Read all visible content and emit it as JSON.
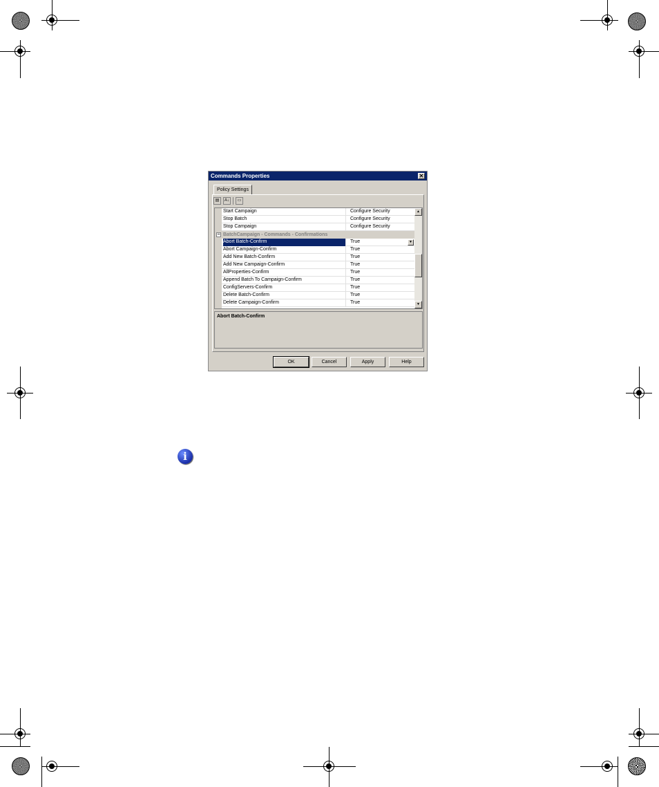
{
  "dialog": {
    "title": "Commands Properties",
    "close_glyph": "✕",
    "tab_label": "Policy Settings",
    "toolbar": {
      "categorized_glyph": "▤",
      "alphabetical_glyph": "A↓",
      "pages_glyph": "▭"
    },
    "rows_top": [
      {
        "name": "Start Campaign",
        "value": "Configure Security"
      },
      {
        "name": "Stop Batch",
        "value": "Configure Security"
      },
      {
        "name": "Stop Campaign",
        "value": "Configure Security"
      }
    ],
    "category": {
      "toggle": "−",
      "label": "BatchCampaign - Commands - Confirmations"
    },
    "rows_bottom": [
      {
        "name": "Abort Batch-Confirm",
        "value": "True"
      },
      {
        "name": "Abort Campaign-Confirm",
        "value": "True"
      },
      {
        "name": "Add New Batch-Confirm",
        "value": "True"
      },
      {
        "name": "Add New Campaign-Confirm",
        "value": "True"
      },
      {
        "name": "AllProperties-Confirm",
        "value": "True"
      },
      {
        "name": "Append Batch To Campaign-Confirm",
        "value": "True"
      },
      {
        "name": "ConfigServers-Confirm",
        "value": "True"
      },
      {
        "name": "Delete Batch-Confirm",
        "value": "True"
      },
      {
        "name": "Delete Campaign-Confirm",
        "value": "True"
      }
    ],
    "dropdown_glyph": "▼",
    "scroll_up_glyph": "▲",
    "scroll_down_glyph": "▼",
    "description_title": "Abort Batch-Confirm",
    "buttons": {
      "ok": "OK",
      "cancel": "Cancel",
      "apply": "Apply",
      "help": "Help"
    }
  },
  "info_icon_glyph": "i"
}
